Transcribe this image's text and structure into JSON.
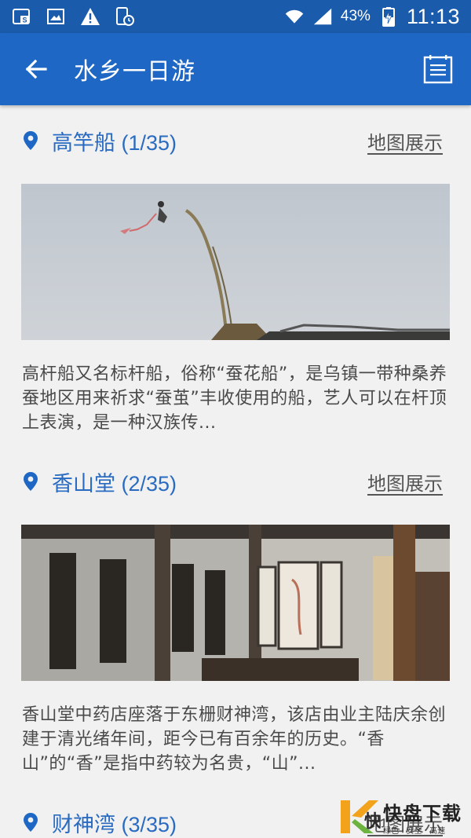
{
  "status": {
    "battery": "43%",
    "time": "11:13"
  },
  "appbar": {
    "title": "水乡一日游"
  },
  "items": [
    {
      "title": "高竿船 (1/35)",
      "map_label": "地图展示",
      "desc": "高杆船又名标杆船，俗称“蚕花船”，是乌镇一带种桑养蚕地区用来祈求“蚕茧”丰收使用的船，艺人可以在杆顶上表演，是一种汉族传..."
    },
    {
      "title": "香山堂 (2/35)",
      "map_label": "地图展示",
      "desc": "香山堂中药店座落于东栅财神湾，该店由业主陆庆余创建于清光绪年间，距今已有百余年的历史。“香山”的“香”是指中药较为名贵，“山”..."
    },
    {
      "title": "财神湾 (3/35)",
      "map_label": "地图展示"
    }
  ],
  "watermark": {
    "main": "快盘下载",
    "sub": "绿色 · 安全 · 高速"
  }
}
